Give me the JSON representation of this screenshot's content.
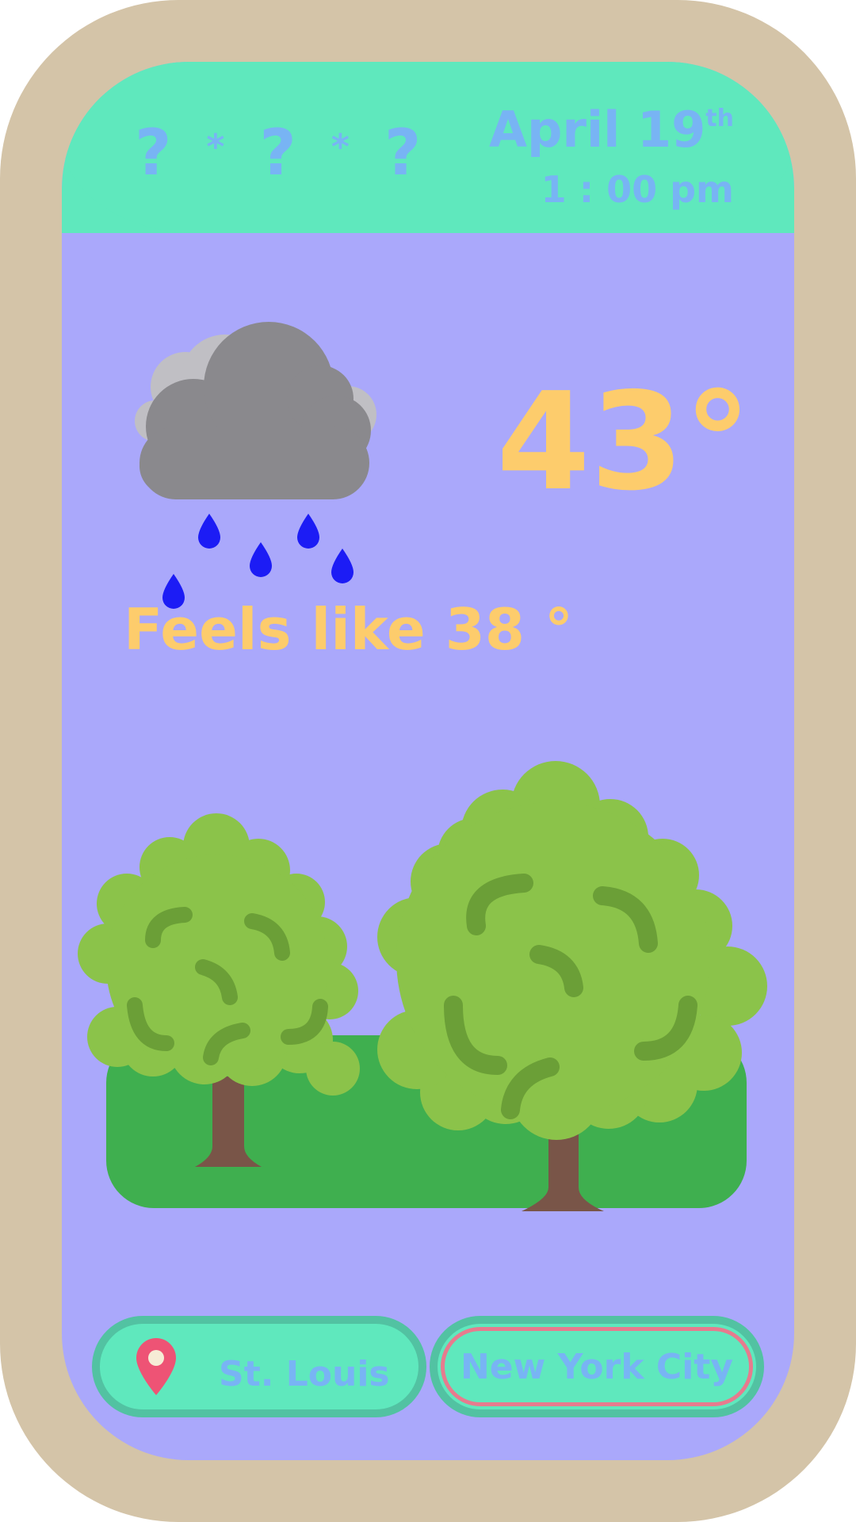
{
  "header": {
    "placeholder": [
      "?",
      "*",
      "?",
      "*",
      "?"
    ],
    "date": "April 19",
    "date_suffix": "th",
    "time": "1 : 00 pm"
  },
  "weather": {
    "icon": "rain-cloud-icon",
    "temperature": "43°",
    "feels_like": "Feels like 38 °"
  },
  "locations": [
    {
      "label": "St. Louis",
      "icon": "map-pin-icon",
      "selected": false
    },
    {
      "label": "New York City",
      "selected": true
    }
  ],
  "colors": {
    "frame": "#d4c4a8",
    "screen": "#aaa8fb",
    "header": "#5fe8bd",
    "accent_text": "#78b4f4",
    "temperature": "#fdcc6c",
    "grass": "#3faf4f",
    "tree": "#8bc34a",
    "trunk": "#795548",
    "selected_outline": "#e77b8e"
  }
}
